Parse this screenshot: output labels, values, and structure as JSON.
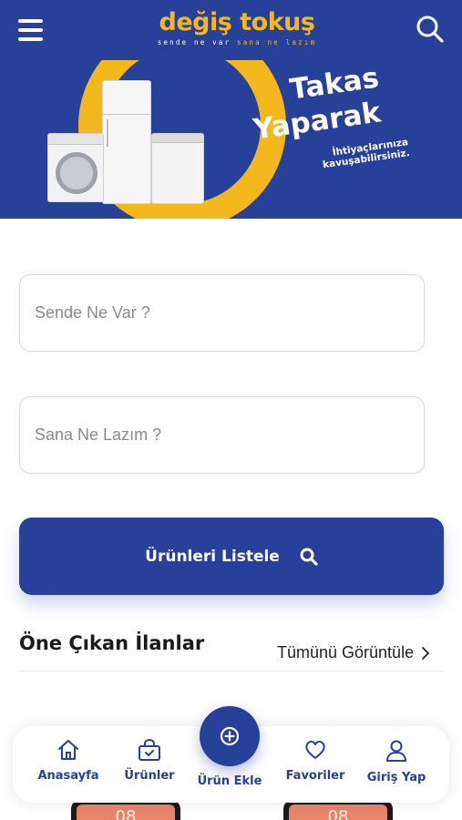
{
  "header": {
    "logo_main": "değiş tokuş",
    "logo_sub_a": "sende ne var",
    "logo_sub_b": "sana ne lazım"
  },
  "banner": {
    "line1": "Takas",
    "line2": "Yaparak",
    "sub": "İhtiyaçlarınıza kavuşabilirsiniz."
  },
  "form": {
    "have_placeholder": "Sende Ne Var ?",
    "need_placeholder": "Sana Ne Lazım ?",
    "list_button": "Ürünleri Listele"
  },
  "featured": {
    "title": "Öne Çıkan İlanlar",
    "view_all": "Tümünü Görüntüle"
  },
  "products": [
    {
      "screen_text": "08"
    },
    {
      "screen_text": "08"
    }
  ],
  "nav": {
    "home": "Anasayfa",
    "products": "Ürünler",
    "add": "Ürün Ekle",
    "favorites": "Favoriler",
    "login": "Giriş Yap"
  },
  "colors": {
    "primary": "#27409a",
    "accent": "#f5b81c"
  },
  "icons": [
    "menu-icon",
    "search-icon",
    "home-icon",
    "shopping-bag-icon",
    "plus-circle-icon",
    "heart-icon",
    "user-icon",
    "chevron-right-icon"
  ]
}
